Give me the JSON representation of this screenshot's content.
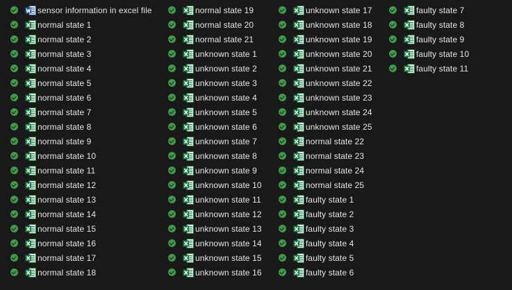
{
  "colors": {
    "background": "#191919",
    "sync_status": "#3f9a4a",
    "excel": "#1d7a44",
    "word": "#2b5797"
  },
  "columns": [
    {
      "items": [
        {
          "label": "sensor information in excel file",
          "icon": "word-document-icon"
        },
        {
          "label": "normal state 1",
          "icon": "excel-file-icon"
        },
        {
          "label": "normal state 2",
          "icon": "excel-file-icon"
        },
        {
          "label": "normal state 3",
          "icon": "excel-file-icon"
        },
        {
          "label": "normal state 4",
          "icon": "excel-file-icon"
        },
        {
          "label": "normal state 5",
          "icon": "excel-file-icon"
        },
        {
          "label": "normal state 6",
          "icon": "excel-file-icon"
        },
        {
          "label": "normal state 7",
          "icon": "excel-file-icon"
        },
        {
          "label": "normal state 8",
          "icon": "excel-file-icon"
        },
        {
          "label": "normal state 9",
          "icon": "excel-file-icon"
        },
        {
          "label": "normal state 10",
          "icon": "excel-file-icon"
        },
        {
          "label": "normal state 11",
          "icon": "excel-file-icon"
        },
        {
          "label": "normal state 12",
          "icon": "excel-file-icon"
        },
        {
          "label": "normal state 13",
          "icon": "excel-file-icon"
        },
        {
          "label": "normal state 14",
          "icon": "excel-file-icon"
        },
        {
          "label": "normal state 15",
          "icon": "excel-file-icon"
        },
        {
          "label": "normal state 16",
          "icon": "excel-file-icon"
        },
        {
          "label": "normal state 17",
          "icon": "excel-file-icon"
        },
        {
          "label": "normal state 18",
          "icon": "excel-file-icon"
        }
      ]
    },
    {
      "items": [
        {
          "label": "normal state 19",
          "icon": "excel-file-icon"
        },
        {
          "label": "normal state 20",
          "icon": "excel-file-icon"
        },
        {
          "label": "normal state 21",
          "icon": "excel-file-icon"
        },
        {
          "label": "unknown state 1",
          "icon": "excel-file-icon"
        },
        {
          "label": "unknown state 2",
          "icon": "excel-file-icon"
        },
        {
          "label": "unknown state 3",
          "icon": "excel-file-icon"
        },
        {
          "label": "unknown state 4",
          "icon": "excel-file-icon"
        },
        {
          "label": "unknown state 5",
          "icon": "excel-file-icon"
        },
        {
          "label": "unknown state 6",
          "icon": "excel-file-icon"
        },
        {
          "label": "unknown state 7",
          "icon": "excel-file-icon"
        },
        {
          "label": "unknown state 8",
          "icon": "excel-file-icon"
        },
        {
          "label": "unknown state 9",
          "icon": "excel-file-icon"
        },
        {
          "label": "unknown state 10",
          "icon": "excel-file-icon"
        },
        {
          "label": "unknown state 11",
          "icon": "excel-file-icon"
        },
        {
          "label": "unknown state 12",
          "icon": "excel-file-icon"
        },
        {
          "label": "unknown state 13",
          "icon": "excel-file-icon"
        },
        {
          "label": "unknown state 14",
          "icon": "excel-file-icon"
        },
        {
          "label": "unknown state 15",
          "icon": "excel-file-icon"
        },
        {
          "label": "unknown state 16",
          "icon": "excel-file-icon"
        }
      ]
    },
    {
      "items": [
        {
          "label": "unknown state 17",
          "icon": "excel-file-icon"
        },
        {
          "label": "unknown state 18",
          "icon": "excel-file-icon"
        },
        {
          "label": "unknown state 19",
          "icon": "excel-file-icon"
        },
        {
          "label": "unknown state 20",
          "icon": "excel-file-icon"
        },
        {
          "label": "unknown state 21",
          "icon": "excel-file-icon"
        },
        {
          "label": "unknown state 22",
          "icon": "excel-file-icon"
        },
        {
          "label": "unknown state 23",
          "icon": "excel-file-icon"
        },
        {
          "label": "unknown state 24",
          "icon": "excel-file-icon"
        },
        {
          "label": "unknown state 25",
          "icon": "excel-file-icon"
        },
        {
          "label": "normal state 22",
          "icon": "excel-file-icon"
        },
        {
          "label": "normal state 23",
          "icon": "excel-file-icon"
        },
        {
          "label": "normal state 24",
          "icon": "excel-file-icon"
        },
        {
          "label": "normal state 25",
          "icon": "excel-file-icon"
        },
        {
          "label": "faulty state 1",
          "icon": "excel-file-icon"
        },
        {
          "label": "faulty state 2",
          "icon": "excel-file-icon"
        },
        {
          "label": "faulty state 3",
          "icon": "excel-file-icon"
        },
        {
          "label": "faulty state 4",
          "icon": "excel-file-icon"
        },
        {
          "label": "faulty state 5",
          "icon": "excel-file-icon"
        },
        {
          "label": "faulty state 6",
          "icon": "excel-file-icon"
        }
      ]
    },
    {
      "items": [
        {
          "label": "faulty state 7",
          "icon": "excel-file-icon"
        },
        {
          "label": "faulty state 8",
          "icon": "excel-file-icon"
        },
        {
          "label": "faulty state 9",
          "icon": "excel-file-icon"
        },
        {
          "label": "faulty state 10",
          "icon": "excel-file-icon"
        },
        {
          "label": "faulty state 11",
          "icon": "excel-file-icon"
        }
      ]
    }
  ]
}
